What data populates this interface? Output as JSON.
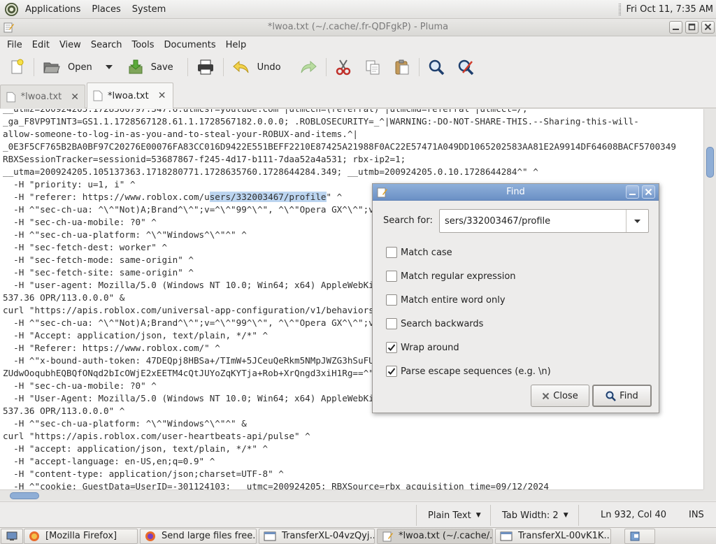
{
  "top_panel": {
    "menus": [
      "Applications",
      "Places",
      "System"
    ],
    "clock": "Fri Oct 11,  7:35 AM"
  },
  "window": {
    "title": "*lwoa.txt (~/.cache/.fr-QDFgkP) - Pluma"
  },
  "menubar": [
    "File",
    "Edit",
    "View",
    "Search",
    "Tools",
    "Documents",
    "Help"
  ],
  "toolbar": {
    "open_label": "Open",
    "save_label": "Save",
    "undo_label": "Undo"
  },
  "tabs": [
    {
      "label": "*lwoa.txt",
      "active": false
    },
    {
      "label": "*lwoa.txt",
      "active": true
    }
  ],
  "editor": {
    "lines": [
      "__utmz=200924205.1728566797.347.6.utmcsr=youtube.com^|utmccn=(referral)^|utmcmd=referral^|utmcct=/;",
      "_ga_F8VP9T1NT3=GS1.1.1728567128.61.1.1728567182.0.0.0; .ROBLOSECURITY=_^|WARNING:-DO-NOT-SHARE-THIS.--Sharing-this-will-",
      "allow-someone-to-log-in-as-you-and-to-steal-your-ROBUX-and-items.^|",
      "_0E3F5CF765B2BA0BF97C20276E00076FA83CC016D9422E551BEFF2210E87425A21988F0AC22E57471A049DD1065202583AA81E2A9914DF64608BACF5700349",
      "RBXSessionTracker=sessionid=53687867-f245-4d17-b111-7daa52a4a531; rbx-ip2=1;",
      "__utma=200924205.105137363.1718280771.1728635760.1728644284.349; __utmb=200924205.0.10.1728644284^\" ^",
      "  -H \"priority: u=1, i\" ^",
      "  -H \"referer: https://www.roblox.com/users/332003467/profile\" ^",
      "  -H ^\"sec-ch-ua: ^\\^\"Not)A;Brand^\\^\";v=^\\^\"99^\\^\", ^\\^\"Opera GX^\\^\";v=^\\^\"113^\\^\", ^\\^\"Chromium^\\^\";v=^\\^\"127^\\^\"^\" ^",
      "  -H \"sec-ch-ua-mobile: ?0\" ^",
      "  -H ^\"sec-ch-ua-platform: ^\\^\"Windows^\\^\"^\" ^",
      "  -H \"sec-fetch-dest: worker\" ^",
      "  -H \"sec-fetch-mode: same-origin\" ^",
      "  -H \"sec-fetch-site: same-origin\" ^",
      "  -H \"user-agent: Mozilla/5.0 (Windows NT 10.0; Win64; x64) AppleWebKit/537.36 (KHTML, like Gecko) Chrome/127.0.0.0 Safari/",
      "537.36 OPR/113.0.0.0\" &",
      "curl \"https://apis.roblox.com/universal-app-configuration/v1/behaviors/app-policy/content\" ^",
      "  -H ^\"sec-ch-ua: ^\\^\"Not)A;Brand^\\^\";v=^\\^\"99^\\^\", ^\\^\"Opera GX^\\^\";v=^\\^\"113^\\^\", ^\\^\"Chromium^\\^\";v=^\\^\"127^\\^\"^\" ^",
      "  -H \"Accept: application/json, text/plain, */*\" ^",
      "  -H \"Referer: https://www.roblox.com/\" ^",
      "  -H ^\"x-bound-auth-token: 47DEQpj8HBSa+/TImW+5JCeuQeRkm5NMpJWZG3hSuFU=|1728644305|",
      "ZUdwOoqubhEQBQfONqd2bIcOWjE2xEETM4cQtJUYoZqKYTja+Rob+XrQngd3xiH1Rg==^\" ^",
      "  -H \"sec-ch-ua-mobile: ?0\" ^",
      "  -H \"User-Agent: Mozilla/5.0 (Windows NT 10.0; Win64; x64) AppleWebKit/537.36 (KHTML, like Gecko) Chrome/127.0.0.0 Safari/",
      "537.36 OPR/113.0.0.0\" ^",
      "  -H ^\"sec-ch-ua-platform: ^\\^\"Windows^\\^\"^\" &",
      "curl \"https://apis.roblox.com/user-heartbeats-api/pulse\" ^",
      "  -H \"accept: application/json, text/plain, */*\" ^",
      "  -H \"accept-language: en-US,en;q=0.9\" ^",
      "  -H \"content-type: application/json;charset=UTF-8\" ^",
      "  -H ^\"cookie: GuestData=UserID=-301124103; __utmc=200924205; RBXSource=rbx_acquisition_time=09/12/2024"
    ],
    "highlight": {
      "line": 7,
      "before": "  -H \"referer: https://www.roblox.com/u",
      "selected": "sers/332003467/profile",
      "after": "\" ^"
    }
  },
  "statusbar": {
    "language": "Plain Text",
    "tab_width": "Tab Width: 2",
    "position": "Ln 932, Col 40",
    "mode": "INS"
  },
  "taskbar": [
    {
      "label": "[Mozilla Firefox]",
      "icon": "firefox-icon"
    },
    {
      "label": "Send large files free...",
      "icon": "firefox-icon"
    },
    {
      "label": "TransferXL-04vzQyj...",
      "icon": "folder-icon"
    },
    {
      "label": "*lwoa.txt (~/.cache/....",
      "icon": "text-editor-icon"
    },
    {
      "label": "TransferXL-00vK1K...",
      "icon": "folder-icon"
    }
  ],
  "find_dialog": {
    "title": "Find",
    "search_label": "Search for:",
    "search_value": "sers/332003467/profile",
    "options": [
      {
        "label": "Match case",
        "checked": false
      },
      {
        "label": "Match regular expression",
        "checked": false
      },
      {
        "label": "Match entire word only",
        "checked": false
      },
      {
        "label": "Search backwards",
        "checked": false
      },
      {
        "label": "Wrap around",
        "checked": true
      },
      {
        "label": "Parse escape sequences (e.g. \\n)",
        "checked": true
      }
    ],
    "close_label": "Close",
    "find_label": "Find"
  },
  "colors": {
    "selection": "#bcd5f0",
    "dialog_titlebar": "#7a9ccf",
    "editor_bg": "#ffffff"
  }
}
